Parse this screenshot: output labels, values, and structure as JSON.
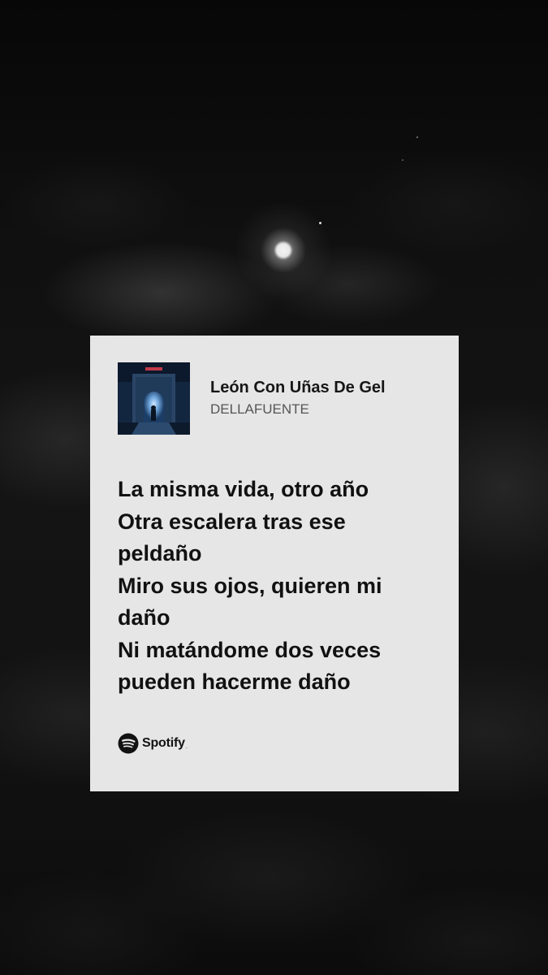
{
  "song": {
    "title": "León Con Uñas De Gel",
    "artist": "DELLAFUENTE",
    "cover_icon": "album-cover-archway"
  },
  "lyrics": [
    "La misma vida, otro año",
    "Otra escalera tras ese",
    "peldaño",
    "Miro sus ojos, quieren mi",
    "daño",
    "Ni matándome dos veces",
    "pueden hacerme daño"
  ],
  "brand": {
    "name": "Spotify",
    "mark": ".",
    "icon": "spotify-logo-icon"
  },
  "colors": {
    "card_background": "#e6e6e6",
    "lyrics_text": "#111111",
    "artist_text": "#555555",
    "sky_background": "#101010"
  }
}
